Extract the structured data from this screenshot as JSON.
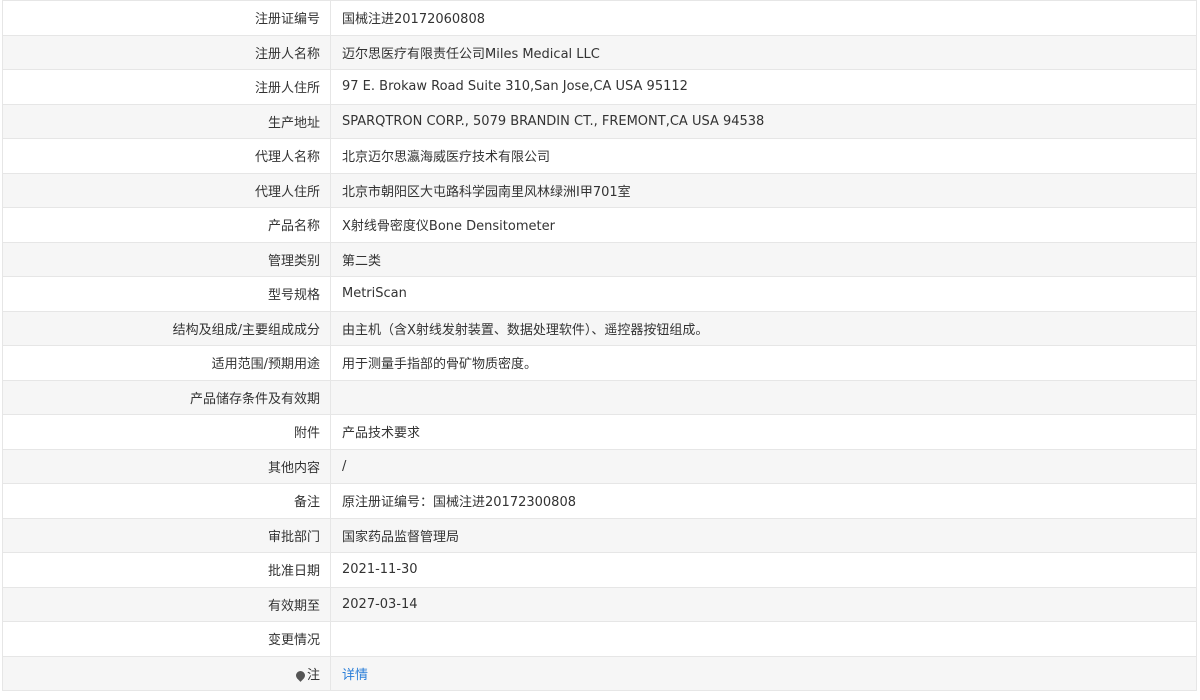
{
  "rows": [
    {
      "label": "注册证编号",
      "value": "国械注进20172060808"
    },
    {
      "label": "注册人名称",
      "value": "迈尔思医疗有限责任公司Miles Medical LLC"
    },
    {
      "label": "注册人住所",
      "value": "97 E. Brokaw Road Suite 310,San Jose,CA USA 95112"
    },
    {
      "label": "生产地址",
      "value": "SPARQTRON CORP., 5079 BRANDIN CT., FREMONT,CA USA 94538"
    },
    {
      "label": "代理人名称",
      "value": "北京迈尔思瀛海威医疗技术有限公司"
    },
    {
      "label": "代理人住所",
      "value": "北京市朝阳区大屯路科学园南里风林绿洲Ⅰ甲701室"
    },
    {
      "label": "产品名称",
      "value": "X射线骨密度仪Bone Densitometer"
    },
    {
      "label": "管理类别",
      "value": "第二类"
    },
    {
      "label": "型号规格",
      "value": "MetriScan"
    },
    {
      "label": "结构及组成/主要组成成分",
      "value": "由主机（含X射线发射装置、数据处理软件）、遥控器按钮组成。"
    },
    {
      "label": "适用范围/预期用途",
      "value": "用于测量手指部的骨矿物质密度。"
    },
    {
      "label": "产品储存条件及有效期",
      "value": ""
    },
    {
      "label": "附件",
      "value": "产品技术要求"
    },
    {
      "label": "其他内容",
      "value": "/"
    },
    {
      "label": "备注",
      "value": "原注册证编号：国械注进20172300808"
    },
    {
      "label": "审批部门",
      "value": "国家药品监督管理局"
    },
    {
      "label": "批准日期",
      "value": "2021-11-30"
    },
    {
      "label": "有效期至",
      "value": "2027-03-14"
    },
    {
      "label": "变更情况",
      "value": ""
    }
  ],
  "note_row": {
    "label": "注",
    "link_text": "详情",
    "icon": "map-pin-icon",
    "link_color": "#2a7ed8"
  },
  "colors": {
    "border": "#e6e6e6",
    "stripe": "#f6f6f6"
  }
}
